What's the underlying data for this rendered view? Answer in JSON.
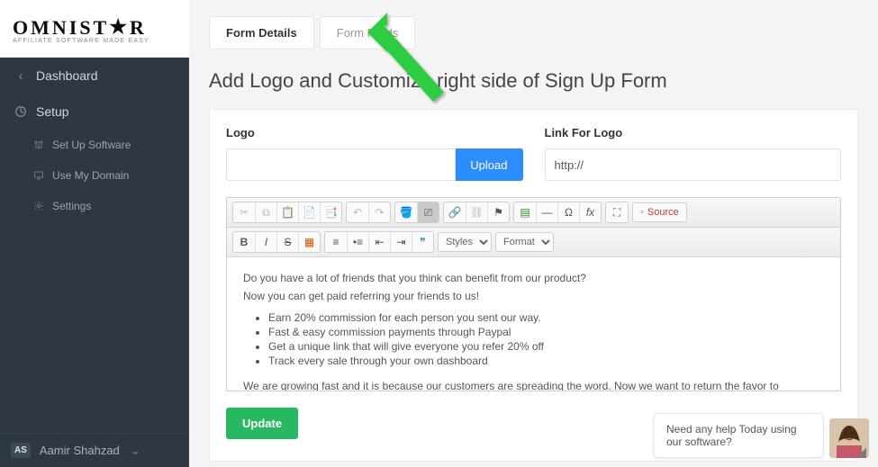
{
  "brand": {
    "name_pre": "OMNIST",
    "name_post": "R",
    "tagline": "AFFILIATE SOFTWARE MADE EASY"
  },
  "sidebar": {
    "dashboard": "Dashboard",
    "setup": "Setup",
    "subs": [
      {
        "label": "Set Up Software"
      },
      {
        "label": "Use My Domain"
      },
      {
        "label": "Settings"
      }
    ]
  },
  "user": {
    "initials": "AS",
    "name": "Aamir Shahzad"
  },
  "tabs": [
    {
      "label": "Form Details",
      "active": true
    },
    {
      "label": "Form Fields",
      "active": false
    }
  ],
  "page_title": "Add Logo and Customize right side of Sign Up Form",
  "fields": {
    "logo_label": "Logo",
    "logo_file": "",
    "upload_label": "Upload",
    "link_label": "Link For Logo",
    "link_value": "http://"
  },
  "editor": {
    "styles_label": "Styles",
    "format_label": "Format",
    "source_label": "Source",
    "fx_label": "fx",
    "content": {
      "intro1": "Do you have a lot of friends that you think can benefit from our product?",
      "intro2": "Now you can get paid referring your friends to us!",
      "bullets": [
        "Earn 20% commission for each person you sent our way.",
        "Fast & easy commission payments through Paypal",
        "Get a unique link that will give everyone you refer 20% off",
        "Track every sale through your own dashboard"
      ],
      "outro": "We are growing fast and it is because our customers are spreading the word. Now we want to return the favor to everyone that has helped us. Start getting paid today!"
    }
  },
  "update_label": "Update",
  "chat_text": "Need any help Today using our software?"
}
